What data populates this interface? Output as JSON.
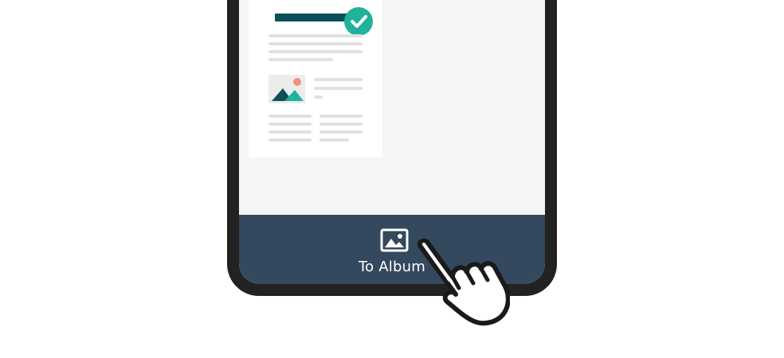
{
  "action_bar": {
    "label": "To Album",
    "icon": "image-album-icon"
  },
  "document": {
    "status_icon": "checkmark-icon"
  },
  "pointer": {
    "icon": "pointing-hand-icon"
  },
  "colors": {
    "frame": "#222222",
    "screen": "#f5f5f5",
    "action_bar": "#34495e",
    "accent": "#20b29b",
    "title_bar": "#0d4f5a",
    "image_sun": "#f4917a"
  }
}
